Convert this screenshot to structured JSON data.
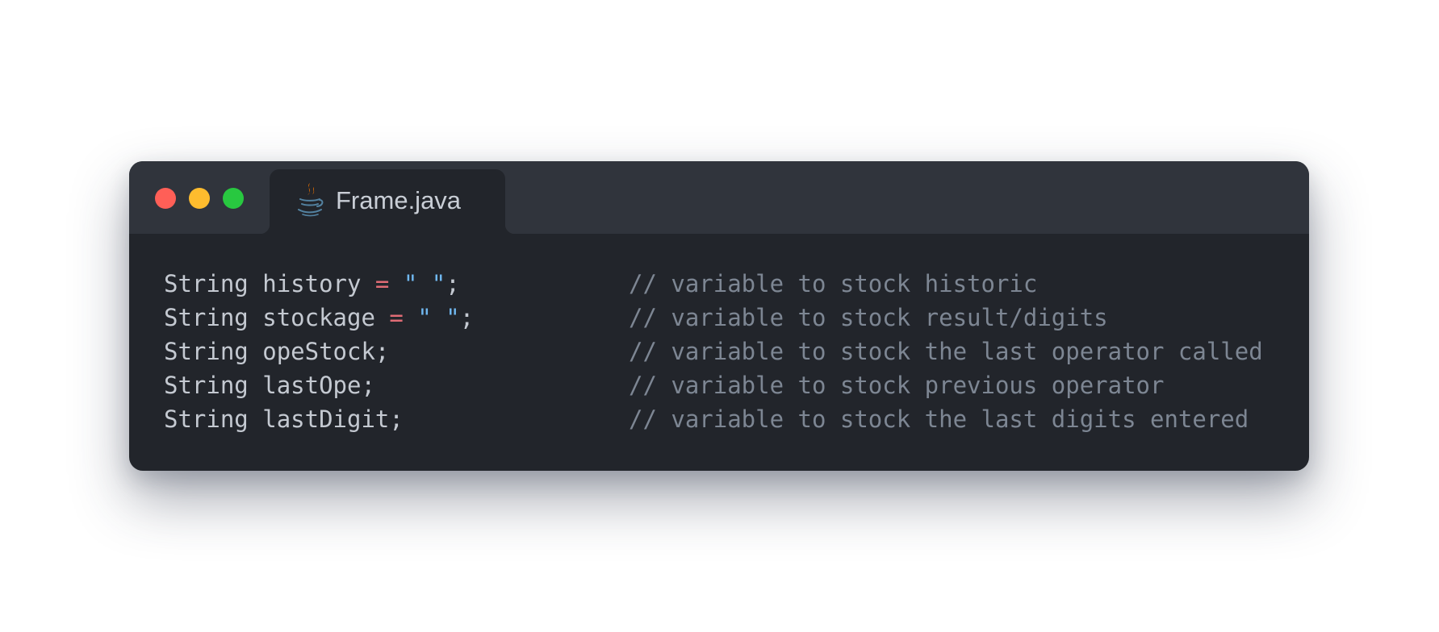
{
  "window": {
    "traffic_lights": [
      "close",
      "minimize",
      "zoom"
    ],
    "tab": {
      "icon": "java-coffee-cup-icon",
      "title": "Frame.java"
    }
  },
  "code": {
    "lines": [
      {
        "type": "String",
        "name": "history",
        "op": "=",
        "value": "\" \"",
        "terminator": ";",
        "comment": "// variable to stock historic"
      },
      {
        "type": "String",
        "name": "stockage",
        "op": "=",
        "value": "\" \"",
        "terminator": ";",
        "comment": "// variable to stock result/digits"
      },
      {
        "type": "String",
        "name": "opeStock",
        "terminator": ";",
        "comment": "// variable to stock the last operator called"
      },
      {
        "type": "String",
        "name": "lastOpe",
        "terminator": ";",
        "comment": "// variable to stock previous operator"
      },
      {
        "type": "String",
        "name": "lastDigit",
        "terminator": ";",
        "comment": "// variable to stock the last digits entered"
      }
    ]
  },
  "colors": {
    "page_background": "#ffffff",
    "editor_background": "#22252b",
    "titlebar_background": "#30343c",
    "close": "#ff5f57",
    "minimize": "#febc2e",
    "zoom": "#28c840",
    "code_text": "#c4c9d1",
    "comment": "#7d8693",
    "operator": "#e06c75",
    "string": "#70b8f0"
  }
}
